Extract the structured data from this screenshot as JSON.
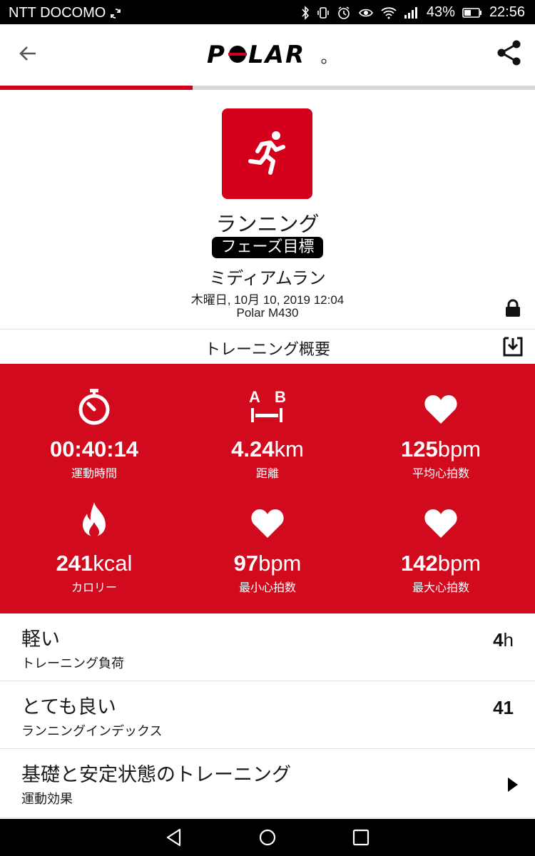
{
  "status_bar": {
    "carrier": "NTT DOCOMO",
    "battery": "43%",
    "time": "22:56"
  },
  "app_bar": {
    "logo_text": "POLAR",
    "progress_percent": 36
  },
  "session": {
    "sport": "ランニング",
    "phase_badge": "フェーズ目標",
    "target_name": "ミディアムラン",
    "date": "木曜日, 10月 10, 2019 12:04",
    "device": "Polar M430"
  },
  "summary": {
    "title": "トレーニング概要"
  },
  "stats": [
    {
      "icon": "stopwatch-icon",
      "value": "00:40:14",
      "unit": "",
      "label": "運動時間"
    },
    {
      "icon": "distance-icon",
      "value": "4.24",
      "unit": "km",
      "label": "距離"
    },
    {
      "icon": "heart-icon",
      "value": "125",
      "unit": "bpm",
      "label": "平均心拍数"
    },
    {
      "icon": "flame-icon",
      "value": "241",
      "unit": "kcal",
      "label": "カロリー"
    },
    {
      "icon": "heart-icon",
      "value": "97",
      "unit": "bpm",
      "label": "最小心拍数"
    },
    {
      "icon": "heart-icon",
      "value": "142",
      "unit": "bpm",
      "label": "最大心拍数"
    }
  ],
  "rows": [
    {
      "main": "軽い",
      "sub": "トレーニング負荷",
      "value": "4",
      "unit": "h"
    },
    {
      "main": "とても良い",
      "sub": "ランニングインデックス",
      "value": "41",
      "unit": ""
    },
    {
      "main": "基礎と安定状態のトレーニング",
      "sub": "運動効果",
      "value": "",
      "unit": ""
    }
  ],
  "colors": {
    "brand_red": "#d20a1e",
    "text": "#1a1a1a"
  }
}
